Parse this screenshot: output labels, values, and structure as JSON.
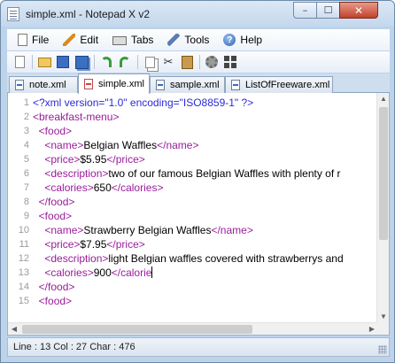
{
  "window": {
    "title": "simple.xml - Notepad X v2",
    "controls": {
      "minimize": "–",
      "maximize": "☐",
      "close": "✕"
    }
  },
  "menu": [
    {
      "label": "File",
      "icon": "file-icon"
    },
    {
      "label": "Edit",
      "icon": "edit-icon"
    },
    {
      "label": "Tabs",
      "icon": "tabs-icon"
    },
    {
      "label": "Tools",
      "icon": "tools-icon"
    },
    {
      "label": "Help",
      "icon": "help-icon"
    }
  ],
  "toolbar": [
    "new-icon",
    "open-icon",
    "save-icon",
    "save-all-icon",
    "undo-icon",
    "redo-icon",
    "copy-icon",
    "cut-icon",
    "paste-icon",
    "settings-icon",
    "grid-icon"
  ],
  "tabs": [
    {
      "label": "note.xml",
      "active": false
    },
    {
      "label": "simple.xml",
      "active": true
    },
    {
      "label": "sample.xml",
      "active": false
    },
    {
      "label": "ListOfFreeware.xml",
      "active": false
    }
  ],
  "editor": {
    "lines": [
      {
        "n": "1",
        "text": "<?xml version=\"1.0\" encoding=\"ISO8859-1\" ?>"
      },
      {
        "n": "2",
        "text": "<breakfast-menu>"
      },
      {
        "n": "3",
        "text": "  <food>"
      },
      {
        "n": "4",
        "text": "    <name>Belgian Waffles</name>"
      },
      {
        "n": "5",
        "text": "    <price>$5.95</price>"
      },
      {
        "n": "6",
        "text": "    <description>two of our famous Belgian Waffles with plenty of r"
      },
      {
        "n": "7",
        "text": "    <calories>650</calories>"
      },
      {
        "n": "8",
        "text": "  </food>"
      },
      {
        "n": "9",
        "text": "  <food>"
      },
      {
        "n": "10",
        "text": "    <name>Strawberry Belgian Waffles</name>"
      },
      {
        "n": "11",
        "text": "    <price>$7.95</price>"
      },
      {
        "n": "12",
        "text": "    <description>light Belgian waffles covered with strawberrys and"
      },
      {
        "n": "13",
        "text": "    <calories>900</calorie"
      },
      {
        "n": "14",
        "text": "  </food>"
      },
      {
        "n": "15",
        "text": "  <food>"
      }
    ],
    "caret_line": "13"
  },
  "status": {
    "text": "Line : 13 Col : 27 Char : 476"
  },
  "colors": {
    "tag": "#9a1c9a",
    "declaration": "#2a2ad8",
    "line_number": "#9a9a9a"
  }
}
